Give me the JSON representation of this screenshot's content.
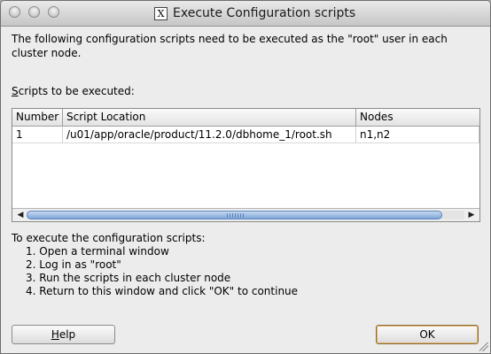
{
  "window": {
    "title": "Execute Configuration scripts",
    "title_icon": "x-window-icon"
  },
  "description": "The following configuration scripts need to be executed as the \"root\" user in each cluster node.",
  "scripts_label_mnemonic": "S",
  "scripts_label_rest": "cripts to be executed:",
  "table": {
    "columns": [
      "Number",
      "Script Location",
      "Nodes"
    ],
    "rows": [
      {
        "number": "1",
        "location": "/u01/app/oracle/product/11.2.0/dbhome_1/root.sh",
        "nodes": "n1,n2"
      }
    ]
  },
  "instructions": {
    "intro": "To execute the configuration scripts:",
    "steps": [
      "1. Open a terminal window",
      "2. Log in as \"root\"",
      "3. Run the scripts in each cluster node",
      "4. Return to this window and click \"OK\" to continue"
    ]
  },
  "buttons": {
    "help_mnemonic": "H",
    "help_rest": "elp",
    "ok": "OK"
  },
  "scroll": {
    "horizontal_fraction_visible": 0.95
  }
}
